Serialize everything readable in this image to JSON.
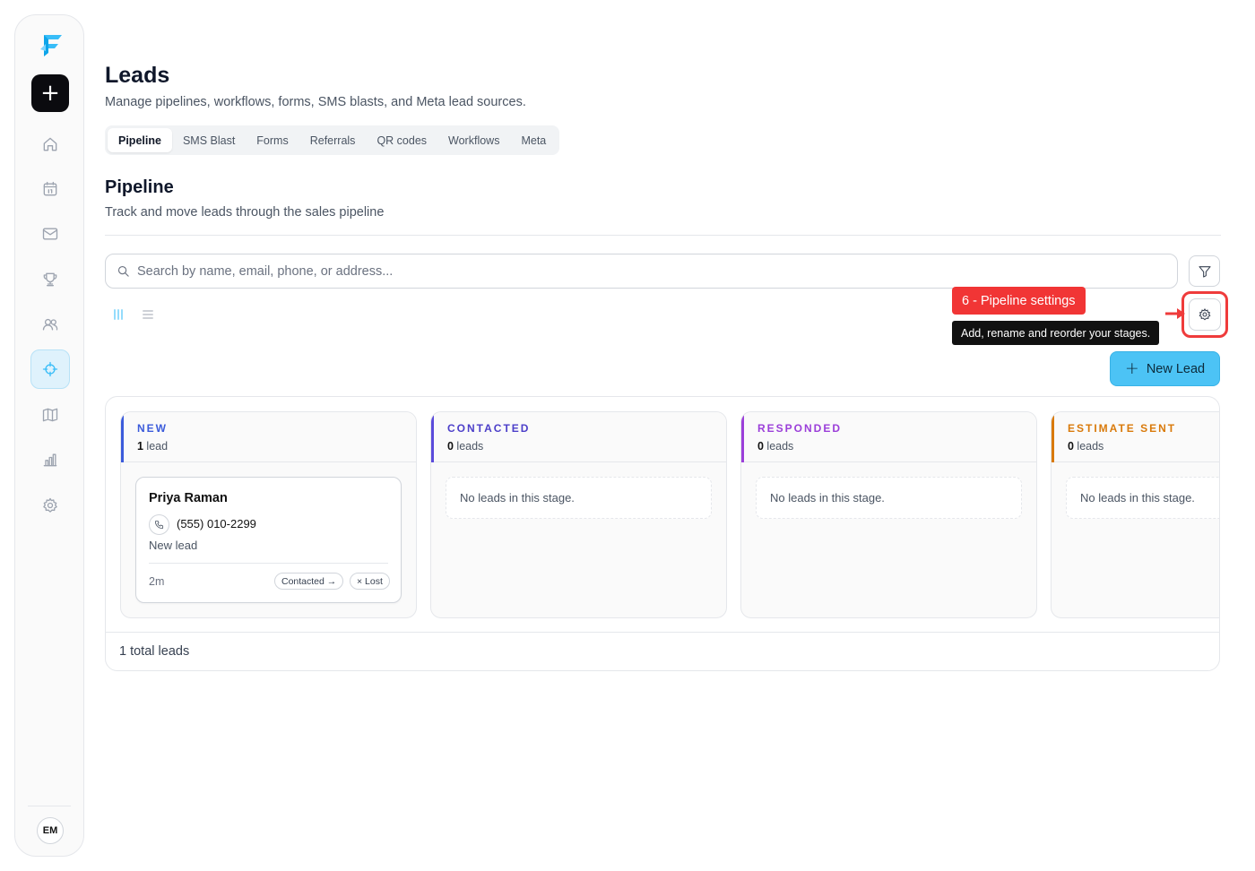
{
  "header": {
    "title": "Leads",
    "subtitle": "Manage pipelines, workflows, forms, SMS blasts, and Meta lead sources."
  },
  "tabs": [
    {
      "label": "Pipeline",
      "active": true
    },
    {
      "label": "SMS Blast"
    },
    {
      "label": "Forms"
    },
    {
      "label": "Referrals"
    },
    {
      "label": "QR codes"
    },
    {
      "label": "Workflows"
    },
    {
      "label": "Meta"
    }
  ],
  "sidebar": {
    "add_label": "+",
    "items": [
      {
        "icon": "home-icon"
      },
      {
        "icon": "calendar-icon"
      },
      {
        "icon": "mail-icon"
      },
      {
        "icon": "trophy-icon"
      },
      {
        "icon": "users-icon"
      },
      {
        "icon": "crosshair-icon",
        "active": true
      },
      {
        "icon": "map-icon"
      },
      {
        "icon": "bar-chart-icon"
      },
      {
        "icon": "gear-icon"
      }
    ],
    "avatar_initials": "EM",
    "accent_color": "#38bdf8"
  },
  "pipeline": {
    "title": "Pipeline",
    "subtitle": "Track and move leads through the sales pipeline",
    "search_placeholder": "Search by name, email, phone, or address...",
    "new_lead_label": "New Lead",
    "total_label": "1 total leads"
  },
  "annotation": {
    "badge": "6 - Pipeline settings",
    "tooltip": "Add, rename and reorder your stages.",
    "color": "#f13535"
  },
  "stages": [
    {
      "name": "NEW",
      "count": "1",
      "unit": " lead",
      "color": "#3b5bdb"
    },
    {
      "name": "CONTACTED",
      "count": "0",
      "unit": " leads",
      "color": "#5b4bdb",
      "empty_text": "No leads in this stage."
    },
    {
      "name": "RESPONDED",
      "count": "0",
      "unit": " leads",
      "color": "#9b3fd9",
      "empty_text": "No leads in this stage."
    },
    {
      "name": "ESTIMATE SENT",
      "count": "0",
      "unit": " leads",
      "color": "#d97a0b",
      "empty_text": "No leads in this stage."
    }
  ],
  "lead": {
    "name": "Priya Raman",
    "phone": "(555) 010-2299",
    "status": "New lead",
    "age": "2m",
    "move_label": "Contacted →",
    "lost_label": "× Lost"
  }
}
